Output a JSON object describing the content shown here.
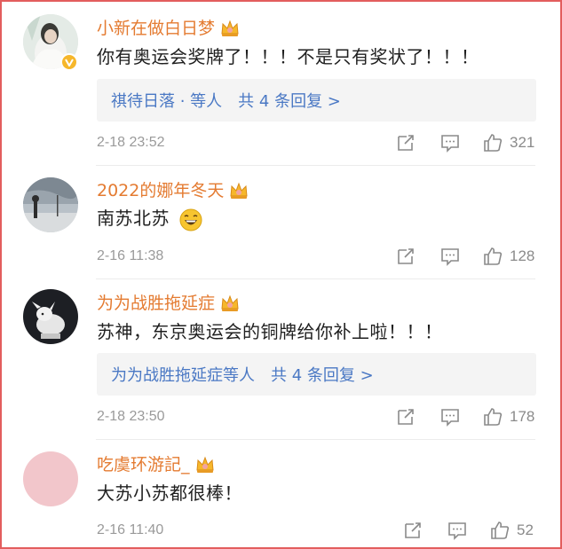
{
  "comments": [
    {
      "username": "小新在做白日梦",
      "text": "你有奥运会奖牌了！！！不是只有奖状了！！！",
      "replies": {
        "names": "祺待日落 · 等人",
        "count": "共 4 条回复 >"
      },
      "time": "2-18 23:52",
      "likes": "321"
    },
    {
      "username": "2022的娜年冬天",
      "text": "南苏北苏",
      "time": "2-16 11:38",
      "likes": "128"
    },
    {
      "username": "为为战胜拖延症",
      "text": "苏神，东京奥运会的铜牌给你补上啦！！！",
      "replies": {
        "names": "为为战胜拖延症等人",
        "count": "共 4 条回复 >"
      },
      "time": "2-18 23:50",
      "likes": "178"
    },
    {
      "username": "吃虞环游記_",
      "text": "大苏小苏都很棒！",
      "time": "2-16 11:40",
      "likes": "52"
    }
  ],
  "icons": {
    "crown": "crown-badge-icon",
    "verified": "verified-badge-icon",
    "share": "share-icon",
    "comment": "comment-icon",
    "like": "like-icon",
    "emoji": "grinning-emoji-icon"
  },
  "colors": {
    "username": "#e47b31",
    "reply_link": "#4a78c4",
    "frame_border": "#e35d5d"
  }
}
